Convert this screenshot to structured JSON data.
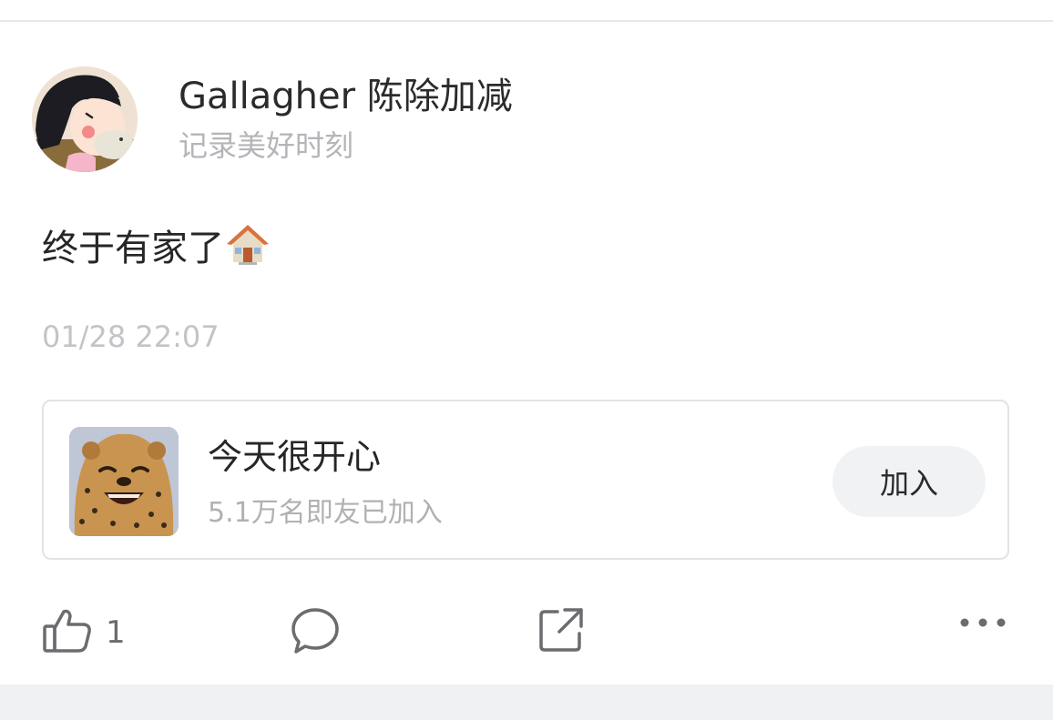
{
  "post": {
    "author": {
      "name": "Gallagher 陈除加减",
      "bio": "记录美好时刻",
      "avatar_icon": "cartoon-girl-avatar"
    },
    "text": "终于有家了",
    "emoji_icon": "house-emoji",
    "timestamp": "01/28 22:07"
  },
  "group_card": {
    "thumbnail_icon": "laughing-cheetah-image",
    "name": "今天很开心",
    "members": "5.1万名即友已加入",
    "join_label": "加入"
  },
  "actions": {
    "like_icon": "thumbs-up-icon",
    "like_count": "1",
    "comment_icon": "comment-bubble-icon",
    "share_icon": "share-icon",
    "more_icon": "more-dots-icon"
  },
  "colors": {
    "primary_text": "#262626",
    "secondary_text": "#b5b5b9",
    "icon_gray": "#6b6b70",
    "card_border": "#e2e3e7",
    "button_bg": "#f1f2f4"
  }
}
